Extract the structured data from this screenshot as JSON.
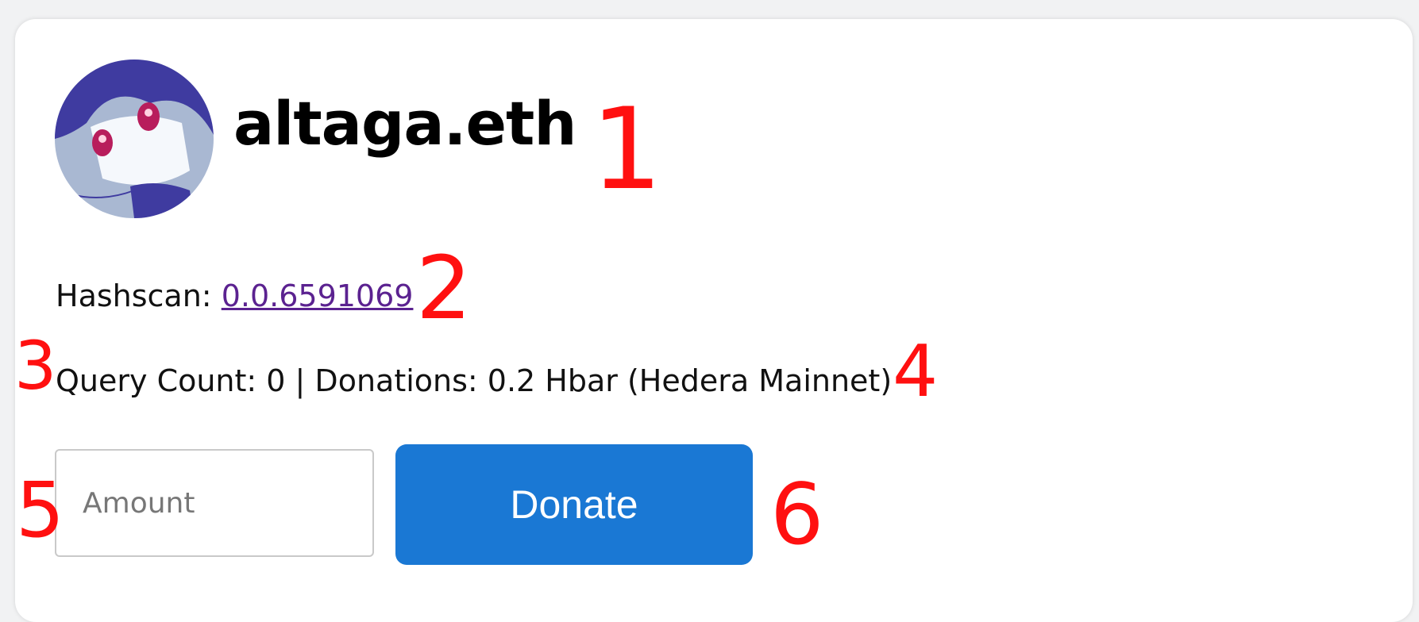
{
  "profile": {
    "name": "altaga.eth",
    "avatar_icon": "anime-character-avatar"
  },
  "hashscan": {
    "label": "Hashscan:",
    "account_id": "0.0.6591069"
  },
  "stats": {
    "text": "Query Count: 0 | Donations: 0.2 Hbar (Hedera Mainnet)"
  },
  "donation": {
    "amount_placeholder": "Amount",
    "amount_value": "",
    "donate_label": "Donate"
  },
  "annotations": {
    "m1": "1",
    "m2": "2",
    "m3": "3",
    "m4": "4",
    "m5": "5",
    "m6": "6"
  },
  "colors": {
    "link": "#5b2290",
    "button": "#1a78d4",
    "annotation": "#ff1010"
  }
}
